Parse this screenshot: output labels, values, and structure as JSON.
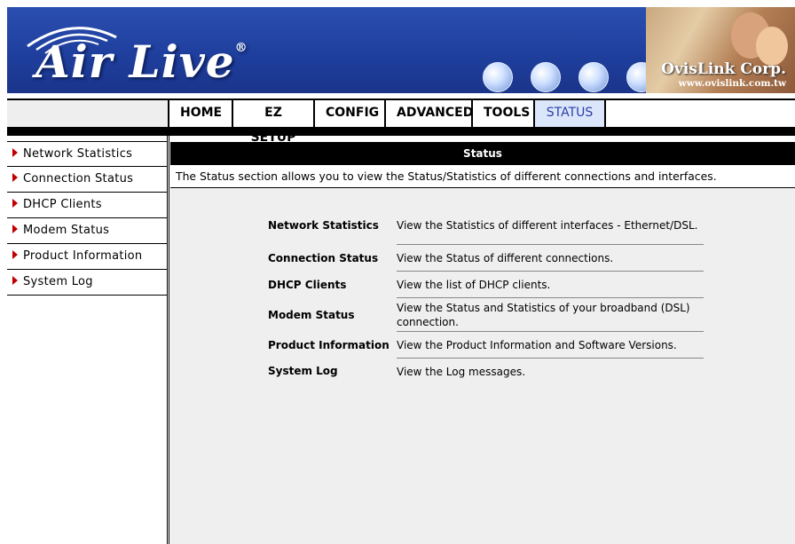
{
  "header": {
    "brand_logo": "Air Live",
    "registered_mark": "®",
    "corp_name": "OvisLink Corp.",
    "corp_url": "www.ovislink.com.tw"
  },
  "nav": {
    "items": [
      "HOME",
      "EZ SETUP",
      "CONFIG",
      "ADVANCED",
      "TOOLS",
      "STATUS"
    ],
    "active": "STATUS"
  },
  "sidebar": {
    "items": [
      "Network Statistics",
      "Connection Status",
      "DHCP Clients",
      "Modem Status",
      "Product Information",
      "System Log"
    ]
  },
  "main": {
    "title": "Status",
    "intro": "The Status section allows you to view the Status/Statistics of different connections and interfaces.",
    "links": [
      {
        "name": "Network Statistics",
        "desc": "View the Statistics of different interfaces - Ethernet/DSL."
      },
      {
        "name": "Connection Status",
        "desc": "View the Status of different connections."
      },
      {
        "name": "DHCP Clients",
        "desc": "View the list of DHCP clients."
      },
      {
        "name": "Modem Status",
        "desc": "View the Status and Statistics of your broadband (DSL) connection."
      },
      {
        "name": "Product Information",
        "desc": "View the Product Information and Software Versions."
      },
      {
        "name": "System Log",
        "desc": "View the Log messages."
      }
    ]
  },
  "colors": {
    "banner_blue": "#1f3f9e",
    "active_tab_bg": "#dbe6fb",
    "active_tab_text": "#2a3ea8",
    "arrow_red": "#c00000"
  }
}
